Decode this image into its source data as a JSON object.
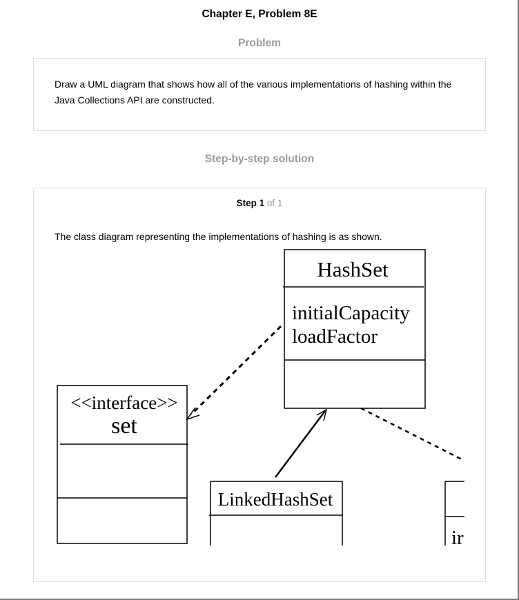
{
  "title": "Chapter E, Problem 8E",
  "problem": {
    "heading": "Problem",
    "text": "Draw a UML diagram that shows how all of the various implementations of hashing within the Java Collections API are constructed."
  },
  "solution": {
    "heading": "Step-by-step solution",
    "step": {
      "label": "Step 1",
      "of": "of 1"
    },
    "text": "The class diagram representing the implementations of hashing is as shown.",
    "diagram": {
      "hashset": {
        "name": "HashSet",
        "attr1": "initialCapacity",
        "attr2": "loadFactor"
      },
      "set": {
        "stereotype": "<<interface>>",
        "name": "set"
      },
      "linkedhashset": {
        "name": "LinkedHashSet"
      },
      "partial_attr": "ir"
    }
  }
}
